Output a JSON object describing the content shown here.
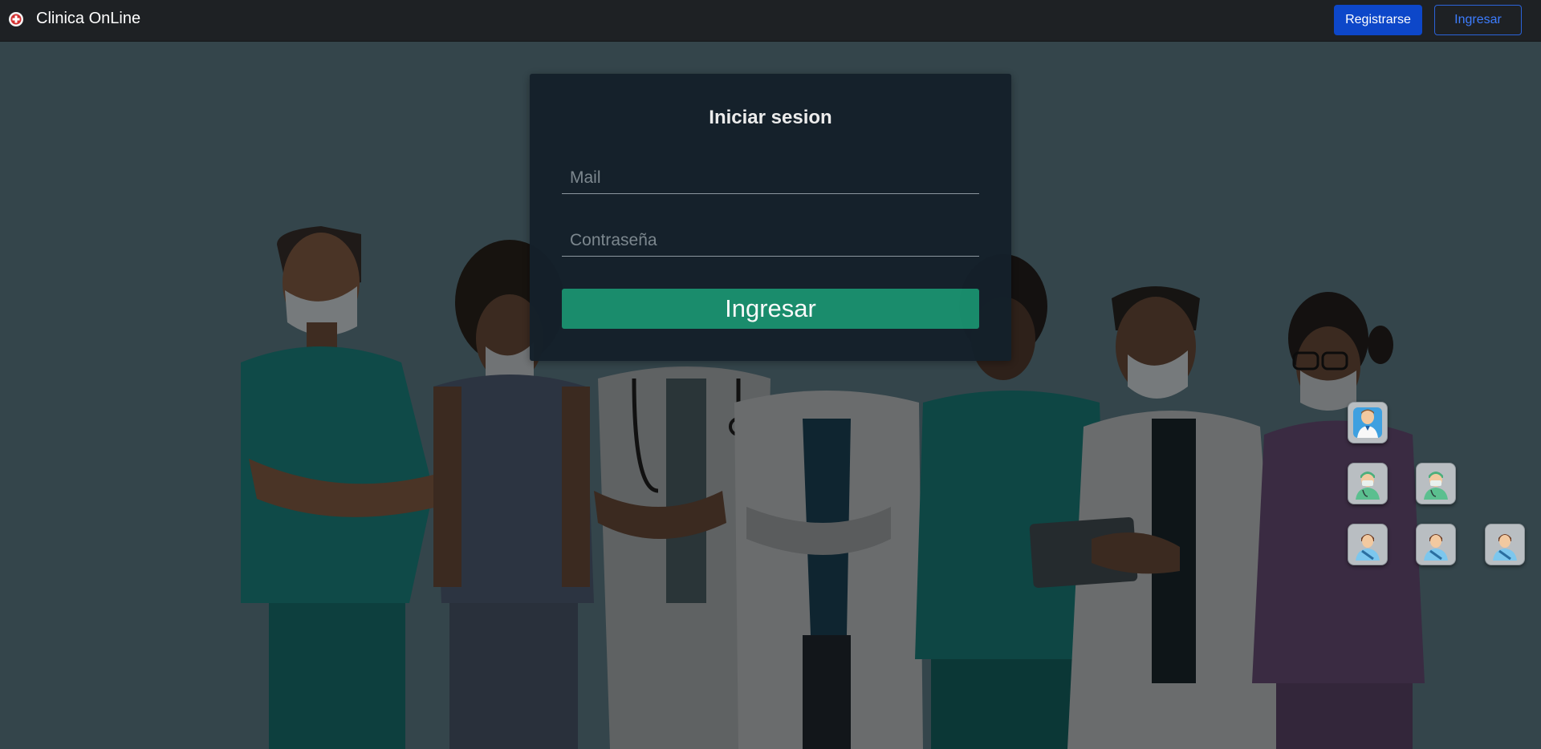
{
  "navbar": {
    "brand_name": "Clinica OnLine",
    "logo_icon": "clinic-logo-icon",
    "register_label": "Registrarse",
    "login_label": "Ingresar"
  },
  "login_form": {
    "title": "Iniciar sesion",
    "mail_placeholder": "Mail",
    "password_placeholder": "Contraseña",
    "submit_label": "Ingresar"
  },
  "quick_access": [
    {
      "role": "admin",
      "icon": "admin-avatar-icon"
    },
    {
      "role": "specialist",
      "icon": "surgeon-avatar-icon"
    },
    {
      "role": "specialist",
      "icon": "surgeon-avatar-icon"
    },
    {
      "role": "patient",
      "icon": "patient-avatar-icon"
    },
    {
      "role": "patient",
      "icon": "patient-avatar-icon"
    },
    {
      "role": "patient",
      "icon": "patient-avatar-icon"
    }
  ],
  "colors": {
    "navbar_bg": "#1e2124",
    "page_bg": "#34454b",
    "card_bg": "#14202a",
    "primary_button": "#0d47c9",
    "submit_button": "#1a8f6e"
  }
}
